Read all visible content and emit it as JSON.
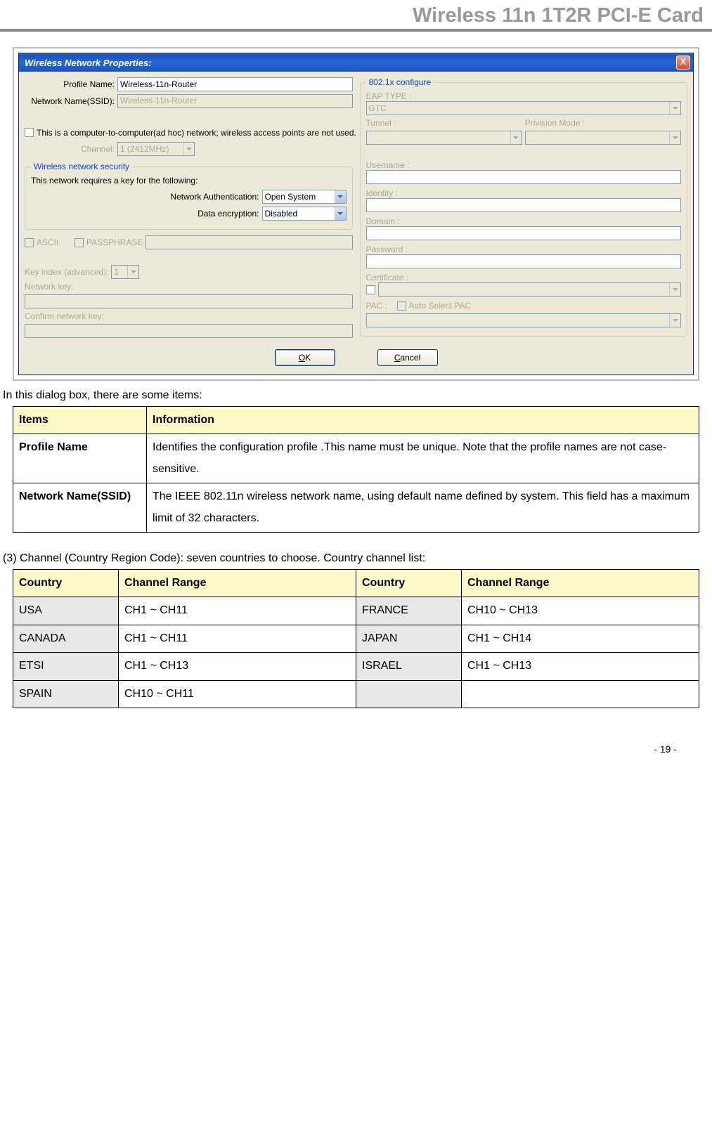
{
  "header": {
    "title": "Wireless 11n 1T2R PCI-E Card"
  },
  "dialog": {
    "title": "Wireless Network Properties:",
    "left": {
      "profile_name_label": "Profile Name:",
      "profile_name_value": "Wireless-11n-Router",
      "ssid_label": "Network Name(SSID):",
      "ssid_value": "Wireless-11n-Router",
      "adhoc_text": "This is a computer-to-computer(ad hoc) network; wireless access points are not used.",
      "channel_label": "Channel:",
      "channel_value": "1 (2412MHz)",
      "security_legend": "Wireless network security",
      "security_note": "This network requires a key for the following:",
      "auth_label": "Network Authentication:",
      "auth_value": "Open System",
      "encryption_label": "Data encryption:",
      "encryption_value": "Disabled",
      "ascii_label": "ASCII",
      "passphrase_label": "PASSPHRASE",
      "keyindex_label": "Key index (advanced):",
      "keyindex_value": "1",
      "networkkey_label": "Network key:",
      "confirmkey_label": "Confirm network key:"
    },
    "right": {
      "legend": "802.1x configure",
      "eap_label": "EAP TYPE :",
      "eap_value": "GTC",
      "tunnel_label": "Tunnel :",
      "provision_label": "Privision Mode :",
      "username_label": "Username :",
      "identity_label": "Identity :",
      "domain_label": "Domain :",
      "password_label": "Password :",
      "certificate_label": "Certificate :",
      "pac_label": "PAC :",
      "autopac_label": "Auto Select PAC"
    },
    "buttons": {
      "ok_u": "O",
      "ok_rest": "K",
      "cancel_u": "C",
      "cancel_rest": "ancel"
    }
  },
  "intro_text": "In this dialog box, there are some items:",
  "items_table": {
    "h1": "Items",
    "h2": "Information",
    "rows": [
      {
        "item": "Profile Name",
        "info": "Identifies the configuration profile .This name must be unique. Note that the profile names are not case-sensitive."
      },
      {
        "item": "Network Name(SSID)",
        "info": "The IEEE 802.11n wireless network name, using default name defined by system. This field has a maximum limit of 32 characters."
      }
    ]
  },
  "section3_text": "(3) Channel (Country Region Code): seven countries to choose. Country channel list:",
  "channel_table": {
    "h1": "Country",
    "h2": "Channel Range",
    "h3": "Country",
    "h4": "Channel Range",
    "rows": [
      {
        "c1": "USA",
        "r1": "CH1 ~ CH11",
        "c2": "FRANCE",
        "r2": "CH10 ~ CH13"
      },
      {
        "c1": "CANADA",
        "r1": "CH1 ~ CH11",
        "c2": "JAPAN",
        "r2": "CH1 ~ CH14"
      },
      {
        "c1": "ETSI",
        "r1": "CH1 ~ CH13",
        "c2": "ISRAEL",
        "r2": "CH1 ~ CH13"
      },
      {
        "c1": "SPAIN",
        "r1": "CH10 ~ CH11",
        "c2": "",
        "r2": ""
      }
    ]
  },
  "footer": "- 19 -"
}
